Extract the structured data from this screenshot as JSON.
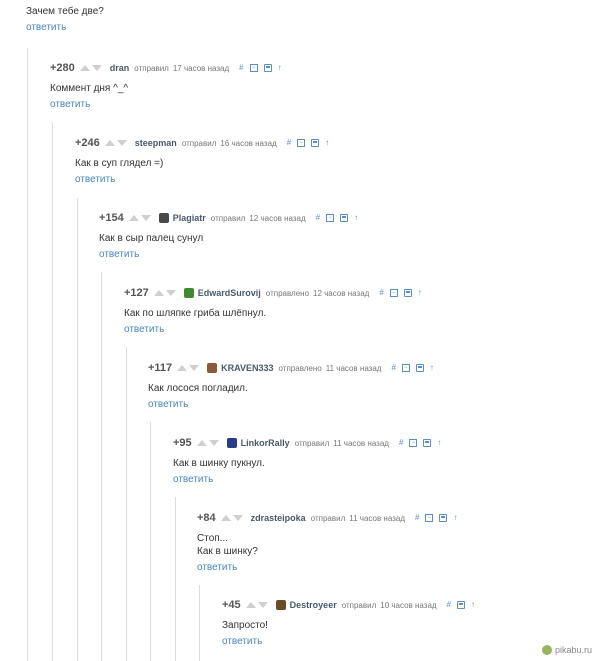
{
  "root": {
    "text": "Зачем тебе две?",
    "reply_label": "ответить"
  },
  "icons": {
    "hash": "#",
    "minus": "−",
    "up": "↑"
  },
  "comments": [
    {
      "rating": "+280",
      "author": "dran",
      "action": "отправил",
      "time": "17 часов назад",
      "lines": [
        "Коммент дня ^_^"
      ],
      "reply_label": "ответить",
      "avatar": null
    },
    {
      "rating": "+246",
      "author": "steepman",
      "action": "отправил",
      "time": "16 часов назад",
      "lines": [
        "Как в суп глядел =)"
      ],
      "reply_label": "ответить",
      "avatar": null
    },
    {
      "rating": "+154",
      "author": "Plagiatr",
      "action": "отправил",
      "time": "12 часов назад",
      "lines": [
        "Как в сыр палец сунул"
      ],
      "reply_label": "ответить",
      "avatar": "#4a4a4a"
    },
    {
      "rating": "+127",
      "author": "EdwardSurovij",
      "action": "отправлено",
      "time": "12 часов назад",
      "lines": [
        "Как по шляпке гриба шлёпнул."
      ],
      "reply_label": "ответить",
      "avatar": "#3f8a2e"
    },
    {
      "rating": "+117",
      "author": "KRAVEN333",
      "action": "отправлено",
      "time": "11 часов назад",
      "lines": [
        "Как лосося погладил."
      ],
      "reply_label": "ответить",
      "avatar": "#8a5a3a"
    },
    {
      "rating": "+95",
      "author": "LinkorRally",
      "action": "отправил",
      "time": "11 часов назад",
      "lines": [
        "Как в шинку пукнул."
      ],
      "reply_label": "ответить",
      "avatar": "#2a3a8a"
    },
    {
      "rating": "+84",
      "author": "zdrasteipoka",
      "action": "отправил",
      "time": "11 часов назад",
      "lines": [
        "Стоп...",
        "Как в шинку?"
      ],
      "reply_label": "ответить",
      "avatar": null
    },
    {
      "rating": "+45",
      "author": "Destroyeer",
      "action": "отправил",
      "time": "10 часов назад",
      "lines": [
        "Запросто!"
      ],
      "reply_label": "ответить",
      "avatar": "#6a4a2a"
    }
  ],
  "watermark": "pikabu.ru"
}
